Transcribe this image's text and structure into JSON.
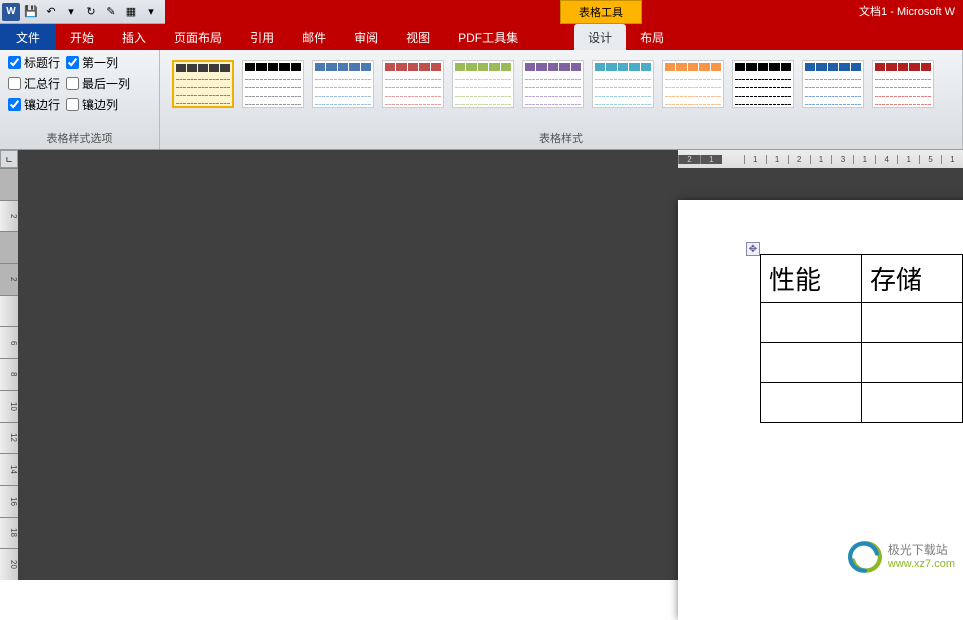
{
  "qat": {
    "save": "💾",
    "undo": "↶",
    "redo": "↻",
    "new": "✎",
    "open": "▦",
    "more": "▾"
  },
  "title_area": {
    "table_tools": "表格工具",
    "doc_title": "文档1 - Microsoft W"
  },
  "tabs": {
    "file": "文件",
    "items": [
      "开始",
      "插入",
      "页面布局",
      "引用",
      "邮件",
      "审阅",
      "视图",
      "PDF工具集"
    ],
    "contextual": [
      "设计",
      "布局"
    ],
    "active": "设计"
  },
  "ribbon": {
    "options_group": {
      "label": "表格样式选项",
      "checkboxes": [
        {
          "label": "标题行",
          "checked": true
        },
        {
          "label": "第一列",
          "checked": true
        },
        {
          "label": "汇总行",
          "checked": false
        },
        {
          "label": "最后一列",
          "checked": false
        },
        {
          "label": "镶边行",
          "checked": true
        },
        {
          "label": "镶边列",
          "checked": false
        }
      ]
    },
    "styles_group": {
      "label": "表格样式"
    }
  },
  "table_styles": [
    {
      "header": "#3b3b3b",
      "body": "#888",
      "selected": true
    },
    {
      "header": "#000",
      "body": "#999"
    },
    {
      "header": "#4a7ab0",
      "body": "#9cc0e0"
    },
    {
      "header": "#c0504d",
      "body": "#e0a0a0"
    },
    {
      "header": "#9bbb59",
      "body": "#c5d8a0"
    },
    {
      "header": "#8064a2",
      "body": "#bba8d0"
    },
    {
      "header": "#4bacc6",
      "body": "#a0d0e0"
    },
    {
      "header": "#f79646",
      "body": "#f8c090"
    },
    {
      "header": "#000",
      "body": "#000"
    },
    {
      "header": "#1f5fa8",
      "body": "#7fa8d8"
    },
    {
      "header": "#b02020",
      "body": "#e08080"
    }
  ],
  "ruler": {
    "corner": "ㄴ",
    "v": [
      "",
      "2",
      "",
      "2",
      "",
      "6",
      "8",
      "10",
      "12",
      "14",
      "16",
      "18",
      "20"
    ],
    "h": [
      "2",
      "1",
      "",
      "1",
      "1",
      "2",
      "1",
      "3",
      "1",
      "4",
      "1",
      "5",
      "1"
    ]
  },
  "document": {
    "anchor": "✥",
    "table": [
      [
        "性能",
        "存储"
      ],
      [
        "",
        ""
      ],
      [
        "",
        ""
      ],
      [
        "",
        ""
      ]
    ]
  },
  "watermark": {
    "name": "极光下载站",
    "url": "www.xz7.com"
  }
}
